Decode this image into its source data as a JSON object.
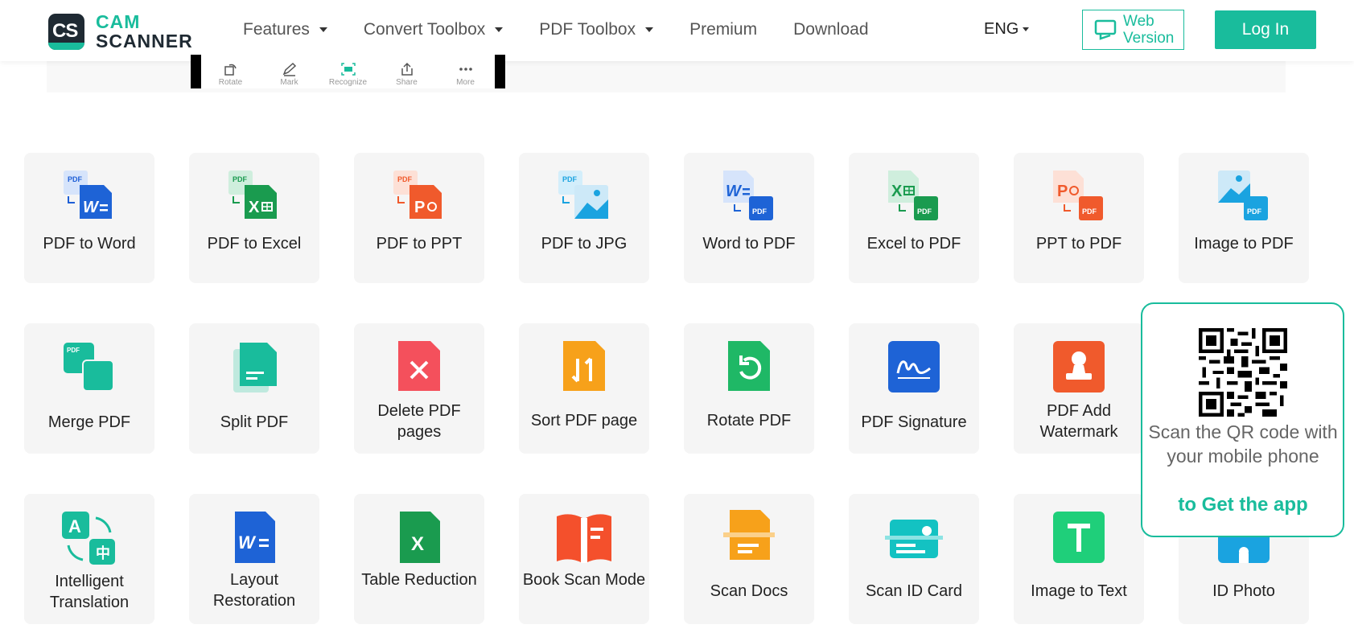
{
  "header": {
    "logo_line1": "CAM",
    "logo_line2": "SCANNER",
    "logo_badge": "CS",
    "nav": [
      {
        "label": "Features",
        "has_caret": true
      },
      {
        "label": "Convert Toolbox",
        "has_caret": true
      },
      {
        "label": "PDF Toolbox",
        "has_caret": true
      },
      {
        "label": "Premium",
        "has_caret": false
      },
      {
        "label": "Download",
        "has_caret": false
      }
    ],
    "language": "ENG",
    "web_version_line1": "Web",
    "web_version_line2": "Version",
    "login_label": "Log In"
  },
  "preview_toolbar": {
    "items": [
      "Rotate",
      "Mark",
      "Recognize",
      "Share",
      "More"
    ]
  },
  "tools": [
    {
      "label": "PDF to Word",
      "icon": "pdf-to-word-icon"
    },
    {
      "label": "PDF to Excel",
      "icon": "pdf-to-excel-icon"
    },
    {
      "label": "PDF to PPT",
      "icon": "pdf-to-ppt-icon"
    },
    {
      "label": "PDF to JPG",
      "icon": "pdf-to-jpg-icon"
    },
    {
      "label": "Word to PDF",
      "icon": "word-to-pdf-icon"
    },
    {
      "label": "Excel to PDF",
      "icon": "excel-to-pdf-icon"
    },
    {
      "label": "PPT to PDF",
      "icon": "ppt-to-pdf-icon"
    },
    {
      "label": "Image to PDF",
      "icon": "image-to-pdf-icon"
    },
    {
      "label": "Merge PDF",
      "icon": "merge-pdf-icon"
    },
    {
      "label": "Split PDF",
      "icon": "split-pdf-icon"
    },
    {
      "label": "Delete PDF pages",
      "icon": "delete-pages-icon"
    },
    {
      "label": "Sort PDF page",
      "icon": "sort-pages-icon"
    },
    {
      "label": "Rotate PDF",
      "icon": "rotate-pdf-icon"
    },
    {
      "label": "PDF Signature",
      "icon": "signature-icon"
    },
    {
      "label": "PDF Add Watermark",
      "icon": "watermark-icon"
    },
    {
      "label": "",
      "icon": "hidden-tool-icon"
    },
    {
      "label": "Intelligent Translation",
      "icon": "translation-icon"
    },
    {
      "label": "Layout Restoration",
      "icon": "layout-restoration-icon"
    },
    {
      "label": "Table Reduction",
      "icon": "table-reduction-icon"
    },
    {
      "label": "Book Scan Mode",
      "icon": "book-scan-icon"
    },
    {
      "label": "Scan Docs",
      "icon": "scan-docs-icon"
    },
    {
      "label": "Scan ID Card",
      "icon": "scan-id-card-icon"
    },
    {
      "label": "Image to Text",
      "icon": "image-to-text-icon"
    },
    {
      "label": "ID Photo",
      "icon": "id-photo-icon"
    }
  ],
  "qr_popup": {
    "text": "Scan the QR code with your mobile phone",
    "cta": "to Get the app"
  },
  "colors": {
    "brand": "#19bc9c",
    "dark": "#1f2a33"
  }
}
